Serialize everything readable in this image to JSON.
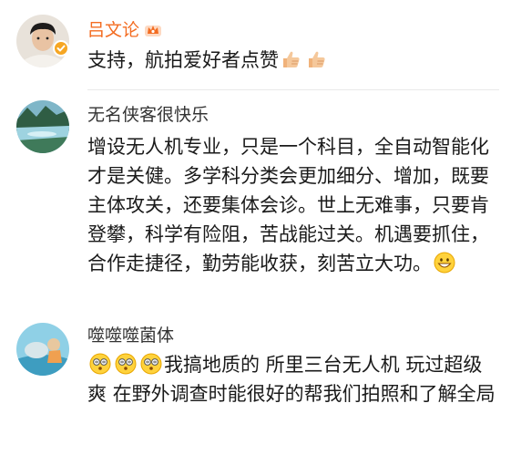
{
  "comments": [
    {
      "author": "吕文论",
      "verified": true,
      "text": "支持，航拍爱好者点赞",
      "emojis": [
        "thumbs-up-emoji",
        "thumbs-up-emoji"
      ]
    },
    {
      "author": "无名侠客很快乐",
      "verified": false,
      "text": "增设无人机专业，只是一个科目，全自动智能化才是关健。多学科分类会更加细分、增加，既要主体攻关，还要集体会诊。世上无难事，只要肯登攀，科学有险阻，苦战能过关。机遇要抓住，合作走捷径，勤劳能收获，刻苦立大功。",
      "emojis": [
        "grin-emoji"
      ]
    },
    {
      "author": "噬噬噬菌体",
      "verified": false,
      "lead_emojis": [
        "dizzy-face-emoji",
        "dizzy-face-emoji",
        "dizzy-face-emoji"
      ],
      "text": "我搞地质的 所里三台无人机 玩过超级爽 在野外调查时能很好的帮我们拍照和了解全局"
    }
  ],
  "colors": {
    "vip_name": "#f36c21",
    "normal_name": "#333333",
    "text": "#1a1a1a",
    "divider": "#e9e9e9",
    "verified_badge": "#f6a623"
  }
}
